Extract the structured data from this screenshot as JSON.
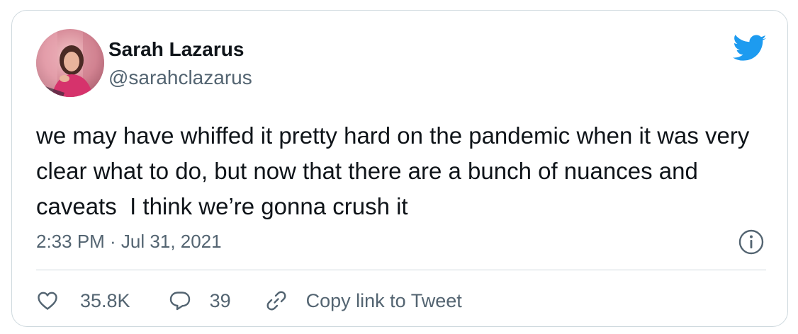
{
  "author": {
    "name": "Sarah Lazarus",
    "handle": "@sarahclazarus"
  },
  "tweet": {
    "text": "we may have whiffed it pretty hard on the pandemic when it was very clear what to do, but now that there are a bunch of nuances and caveats  I think we’re gonna crush it",
    "timestamp": "2:33 PM · Jul 31, 2021"
  },
  "actions": {
    "likes": "35.8K",
    "replies": "39",
    "copy_link": "Copy link to Tweet"
  },
  "icons": {
    "brand": "twitter-bird-icon",
    "info": "info-icon",
    "like": "heart-icon",
    "reply": "reply-bubble-icon",
    "copy": "link-icon"
  },
  "colors": {
    "brand": "#1d9bf0",
    "text": "#0f1419",
    "secondary": "#536471",
    "border": "#cfd9de"
  }
}
